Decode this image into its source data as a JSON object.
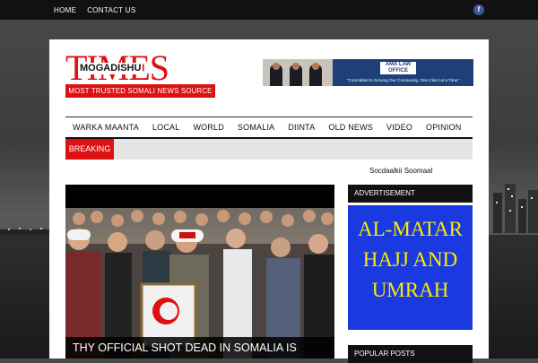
{
  "topbar": {
    "links": [
      "HOME",
      "CONTACT US"
    ],
    "social_icon": "facebook-icon"
  },
  "logo": {
    "times": "TIMES",
    "city": "MOGADISHU",
    "tagline": "MOST TRUSTED SOMALI NEWS SOURCE"
  },
  "ad_top": {
    "law_label": "AMA LAW OFFICE",
    "slogan": "\"Committed to Serving Our Community, One Client at a Time.\""
  },
  "nav": {
    "items": [
      "WARKA MAANTA",
      "LOCAL",
      "WORLD",
      "SOMALIA",
      "DIINTA",
      "OLD NEWS",
      "VIDEO",
      "OPINION"
    ]
  },
  "breaking": {
    "label": "BREAKING"
  },
  "subline": "Socdaalkii Soomaal",
  "featured": {
    "headline": "THY OFFICIAL SHOT DEAD IN SOMALIA IS"
  },
  "sidebar": {
    "advertisement_label": "ADVERTISEMENT",
    "ad_text": [
      "AL-MATAR",
      "HAJJ AND",
      "UMRAH"
    ],
    "popular_label": "POPULAR POSTS"
  },
  "colors": {
    "accent_red": "#dd1111",
    "ad_blue": "#1a39e0",
    "ad_yellow": "#ffea00"
  }
}
